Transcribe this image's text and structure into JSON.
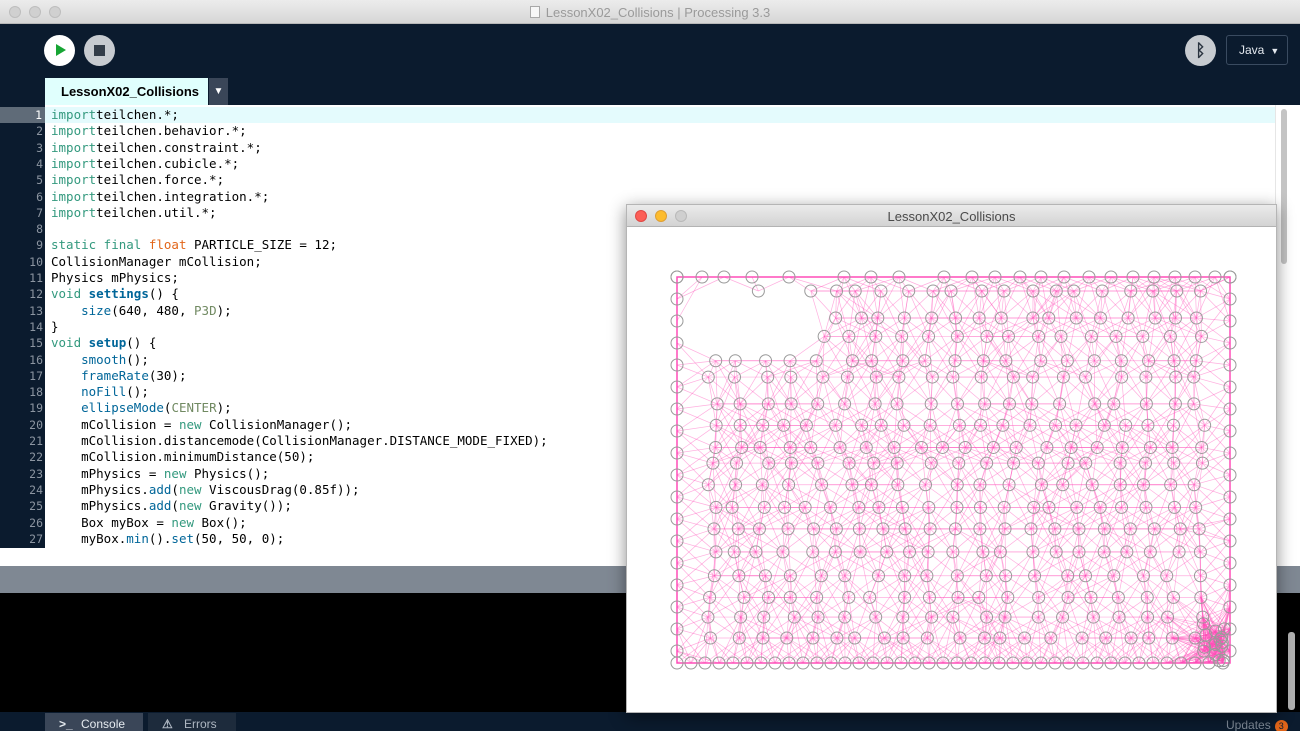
{
  "window": {
    "title": "LessonX02_Collisions | Processing 3.3"
  },
  "toolbar": {
    "run_label": "Run",
    "stop_label": "Stop",
    "debug_label": "Debug",
    "mode": "Java"
  },
  "tab": {
    "name": "LessonX02_Collisions"
  },
  "editor": {
    "current_line": 1,
    "lines": [
      [
        [
          "kw",
          "import"
        ],
        [
          "",
          "teilchen.*;"
        ]
      ],
      [
        [
          "kw",
          "import"
        ],
        [
          "",
          "teilchen.behavior.*;"
        ]
      ],
      [
        [
          "kw",
          "import"
        ],
        [
          "",
          "teilchen.constraint.*;"
        ]
      ],
      [
        [
          "kw",
          "import"
        ],
        [
          "",
          "teilchen.cubicle.*;"
        ]
      ],
      [
        [
          "kw",
          "import"
        ],
        [
          "",
          "teilchen.force.*;"
        ]
      ],
      [
        [
          "kw",
          "import"
        ],
        [
          "",
          "teilchen.integration.*;"
        ]
      ],
      [
        [
          "kw",
          "import"
        ],
        [
          "",
          "teilchen.util.*;"
        ]
      ],
      [],
      [
        [
          "kw",
          "static final"
        ],
        [
          "",
          " "
        ],
        [
          "ty",
          "float"
        ],
        [
          "",
          " PARTICLE_SIZE = 12;"
        ]
      ],
      [
        [
          "",
          "CollisionManager mCollision;"
        ]
      ],
      [
        [
          "",
          "Physics mPhysics;"
        ]
      ],
      [
        [
          "kw",
          "void"
        ],
        [
          "",
          " "
        ],
        [
          "fnb",
          "settings"
        ],
        [
          "",
          "() {"
        ]
      ],
      [
        [
          "",
          "    "
        ],
        [
          "fn",
          "size"
        ],
        [
          "",
          "(640, 480, "
        ],
        [
          "cn",
          "P3D"
        ],
        [
          "",
          ");"
        ]
      ],
      [
        [
          "",
          "}"
        ]
      ],
      [
        [
          "kw",
          "void"
        ],
        [
          "",
          " "
        ],
        [
          "fnb",
          "setup"
        ],
        [
          "",
          "() {"
        ]
      ],
      [
        [
          "",
          "    "
        ],
        [
          "fn",
          "smooth"
        ],
        [
          "",
          "();"
        ]
      ],
      [
        [
          "",
          "    "
        ],
        [
          "fn",
          "frameRate"
        ],
        [
          "",
          "(30);"
        ]
      ],
      [
        [
          "",
          "    "
        ],
        [
          "fn",
          "noFill"
        ],
        [
          "",
          "();"
        ]
      ],
      [
        [
          "",
          "    "
        ],
        [
          "fn",
          "ellipseMode"
        ],
        [
          "",
          "("
        ],
        [
          "cn",
          "CENTER"
        ],
        [
          "",
          ");"
        ]
      ],
      [
        [
          "",
          "    mCollision = "
        ],
        [
          "kw",
          "new"
        ],
        [
          "",
          " CollisionManager();"
        ]
      ],
      [
        [
          "",
          "    mCollision.distancemode(CollisionManager.DISTANCE_MODE_FIXED);"
        ]
      ],
      [
        [
          "",
          "    mCollision.minimumDistance(50);"
        ]
      ],
      [
        [
          "",
          "    mPhysics = "
        ],
        [
          "kw",
          "new"
        ],
        [
          "",
          " Physics();"
        ]
      ],
      [
        [
          "",
          "    mPhysics."
        ],
        [
          "fn",
          "add"
        ],
        [
          "",
          "("
        ],
        [
          "kw",
          "new"
        ],
        [
          "",
          " ViscousDrag(0.85f));"
        ]
      ],
      [
        [
          "",
          "    mPhysics."
        ],
        [
          "fn",
          "add"
        ],
        [
          "",
          "("
        ],
        [
          "kw",
          "new"
        ],
        [
          "",
          " Gravity());"
        ]
      ],
      [
        [
          "",
          "    Box myBox = "
        ],
        [
          "kw",
          "new"
        ],
        [
          "",
          " Box();"
        ]
      ],
      [
        [
          "",
          "    myBox."
        ],
        [
          "fn",
          "min"
        ],
        [
          "",
          "()."
        ],
        [
          "fn",
          "set"
        ],
        [
          "",
          "(50, 50, 0);"
        ]
      ]
    ]
  },
  "footer": {
    "console_label": "Console",
    "errors_label": "Errors",
    "updates_label": "Updates",
    "updates_count": "3"
  },
  "sketch": {
    "title": "LessonX02_Collisions"
  },
  "colors": {
    "background": "#0b1b2e",
    "keyword": "#33997e",
    "type": "#e2661a",
    "function": "#006699",
    "constant": "#718a62",
    "particle_link": "#ff4db8"
  }
}
